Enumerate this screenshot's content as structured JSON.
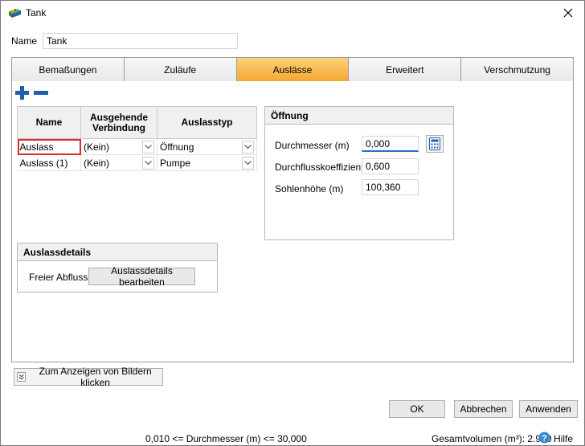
{
  "window": {
    "title": "Tank",
    "close_icon": "close-icon",
    "app_icon": "tank-app-icon"
  },
  "name_field": {
    "label": "Name",
    "value": "Tank"
  },
  "tabs": [
    {
      "label": "Bemaßungen",
      "active": false
    },
    {
      "label": "Zuläufe",
      "active": false
    },
    {
      "label": "Auslässe",
      "active": true
    },
    {
      "label": "Erweitert",
      "active": false
    },
    {
      "label": "Verschmutzung",
      "active": false
    }
  ],
  "toolbar": {
    "add_icon": "plus-icon",
    "remove_icon": "minus-icon"
  },
  "grid": {
    "headers": {
      "name": "Name",
      "connection": "Ausgehende Verbindung",
      "type": "Auslasstyp"
    },
    "rows": [
      {
        "name": "Auslass",
        "connection": "(Kein)",
        "type": "Öffnung"
      },
      {
        "name": "Auslass (1)",
        "connection": "(Kein)",
        "type": "Pumpe"
      }
    ]
  },
  "opening": {
    "title": "Öffnung",
    "diameter_label": "Durchmesser (m)",
    "diameter_value": "0,000",
    "coefficient_label": "Durchflusskoeffizient",
    "coefficient_value": "0,600",
    "bottom_label": "Sohlenhöhe (m)",
    "bottom_value": "100,360",
    "calc_icon": "calculator-icon"
  },
  "details": {
    "title": "Auslassdetails",
    "free_outflow_label": "Freier Abfluss",
    "edit_button": "Auslassdetails bearbeiten"
  },
  "images_button": "Zum Anzeigen von Bildern klicken",
  "buttons": {
    "ok": "OK",
    "cancel": "Abbrechen",
    "apply": "Anwenden"
  },
  "status": {
    "range": "0,010 <= Durchmesser (m) <= 30,000",
    "volume": "Gesamtvolumen (m³): 2.990",
    "help": "Hilfe"
  },
  "colors": {
    "active_tab": "#f5a731",
    "accent_blue": "#1f5fae",
    "selection_red": "#d92b2b"
  }
}
